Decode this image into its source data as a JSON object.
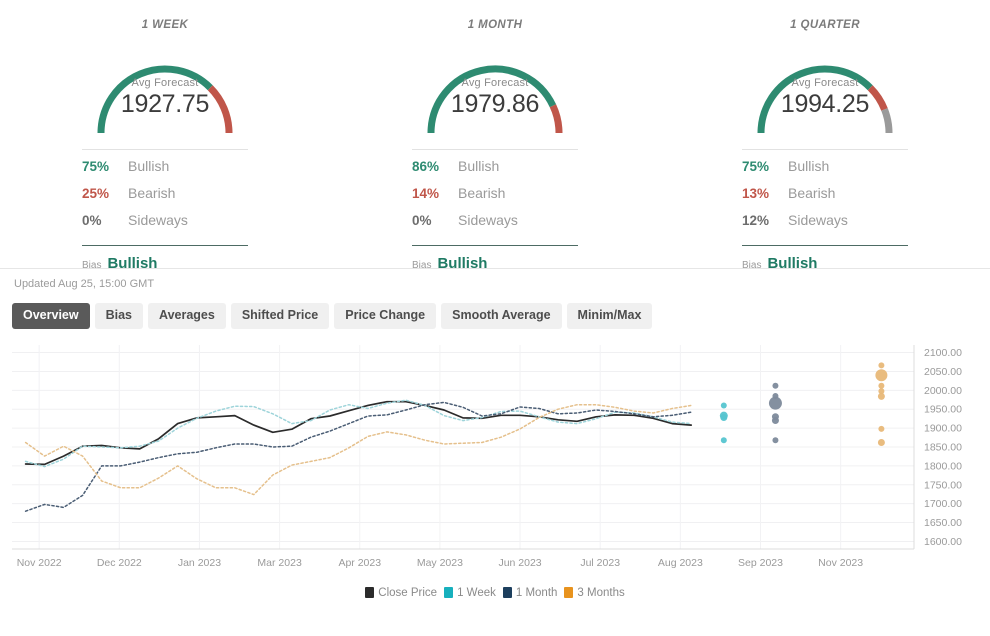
{
  "cards": [
    {
      "title": "1 WEEK",
      "gauge_label": "Avg Forecast",
      "value": "1927.75",
      "bullish_pct": "75%",
      "bullish_label": "Bullish",
      "bearish_pct": "25%",
      "bearish_label": "Bearish",
      "sideways_pct": "0%",
      "sideways_label": "Sideways",
      "bias_label": "Bias",
      "bias_value": "Bullish",
      "arc": {
        "bull": 75,
        "bear": 25,
        "side": 0
      }
    },
    {
      "title": "1 MONTH",
      "gauge_label": "Avg Forecast",
      "value": "1979.86",
      "bullish_pct": "86%",
      "bullish_label": "Bullish",
      "bearish_pct": "14%",
      "bearish_label": "Bearish",
      "sideways_pct": "0%",
      "sideways_label": "Sideways",
      "bias_label": "Bias",
      "bias_value": "Bullish",
      "arc": {
        "bull": 86,
        "bear": 14,
        "side": 0
      }
    },
    {
      "title": "1 QUARTER",
      "gauge_label": "Avg Forecast",
      "value": "1994.25",
      "bullish_pct": "75%",
      "bullish_label": "Bullish",
      "bearish_pct": "13%",
      "bearish_label": "Bearish",
      "sideways_pct": "12%",
      "sideways_label": "Sideways",
      "bias_label": "Bias",
      "bias_value": "Bullish",
      "arc": {
        "bull": 75,
        "bear": 13,
        "side": 12
      }
    }
  ],
  "updated": "Updated Aug 25, 15:00 GMT",
  "tabs": [
    {
      "label": "Overview",
      "active": true
    },
    {
      "label": "Bias",
      "active": false
    },
    {
      "label": "Averages",
      "active": false
    },
    {
      "label": "Shifted Price",
      "active": false
    },
    {
      "label": "Price Change",
      "active": false
    },
    {
      "label": "Smooth Average",
      "active": false
    },
    {
      "label": "Minim/Max",
      "active": false
    }
  ],
  "colors": {
    "bullish": "#2e8b71",
    "bearish": "#c0564a",
    "sideways": "#9a9a9a",
    "close_price": "#2b2b2b",
    "one_week": "#17b0bd",
    "one_month": "#1d3f5e",
    "three_months": "#e8931e"
  },
  "chart_data": {
    "type": "line",
    "title": "",
    "xlabel": "",
    "ylabel": "",
    "ylim": [
      1580,
      2120
    ],
    "yticks": [
      "1600.00",
      "1650.00",
      "1700.00",
      "1750.00",
      "1800.00",
      "1850.00",
      "1900.00",
      "1950.00",
      "2000.00",
      "2050.00",
      "2100.00"
    ],
    "xticks": [
      "Nov 2022",
      "Dec 2022",
      "Jan 2023",
      "Mar 2023",
      "Apr 2023",
      "May 2023",
      "Jun 2023",
      "Jul 2023",
      "Aug 2023",
      "Sep 2023",
      "Nov 2023"
    ],
    "grid": true,
    "legend_position": "bottom",
    "legend": [
      "Close Price",
      "1 Week",
      "1 Month",
      "3 Months"
    ],
    "series": [
      {
        "name": "Close Price",
        "style": "solid",
        "color": "#2b2b2b",
        "x": [
          0.5,
          1.2,
          1.9,
          2.6,
          3.3,
          4.0,
          4.7,
          5.4,
          6.1,
          6.8,
          7.5,
          8.2,
          8.9,
          9.6,
          10.3,
          11.0,
          11.7,
          12.4,
          13.1,
          13.8,
          14.5,
          15.2,
          15.9,
          16.6,
          17.3,
          18.0,
          18.7,
          19.4,
          20.1,
          20.8,
          21.5,
          22.2,
          22.9,
          23.6,
          24.3,
          25.0
        ],
        "values": [
          1805,
          1804,
          1826,
          1852,
          1854,
          1848,
          1845,
          1872,
          1912,
          1927,
          1930,
          1933,
          1908,
          1889,
          1897,
          1925,
          1932,
          1946,
          1960,
          1970,
          1970,
          1960,
          1948,
          1927,
          1926,
          1934,
          1934,
          1930,
          1922,
          1918,
          1930,
          1935,
          1934,
          1926,
          1912,
          1908
        ]
      },
      {
        "name": "1 Week",
        "style": "dotted",
        "color": "#9ed4da",
        "x": [
          0.5,
          1.2,
          1.9,
          2.6,
          3.3,
          4.0,
          4.7,
          5.4,
          6.1,
          6.8,
          7.5,
          8.2,
          8.9,
          9.6,
          10.3,
          11.0,
          11.7,
          12.4,
          13.1,
          13.8,
          14.5,
          15.2,
          15.9,
          16.6,
          17.3,
          18.0,
          18.7,
          19.4,
          20.1,
          20.8,
          21.5,
          22.2,
          22.9,
          23.6,
          24.3,
          25.0
        ],
        "values": [
          1812,
          1798,
          1818,
          1852,
          1850,
          1848,
          1852,
          1866,
          1900,
          1926,
          1945,
          1958,
          1957,
          1938,
          1912,
          1920,
          1948,
          1962,
          1952,
          1966,
          1974,
          1960,
          1933,
          1920,
          1928,
          1944,
          1945,
          1930,
          1916,
          1912,
          1925,
          1942,
          1940,
          1930,
          1916,
          1912
        ]
      },
      {
        "name": "1 Month",
        "style": "dotted",
        "color": "#4a5d74",
        "x": [
          0.5,
          1.2,
          1.9,
          2.6,
          3.3,
          4.0,
          4.7,
          5.4,
          6.1,
          6.8,
          7.5,
          8.2,
          8.9,
          9.6,
          10.3,
          11.0,
          11.7,
          12.4,
          13.1,
          13.8,
          14.5,
          15.2,
          15.9,
          16.6,
          17.3,
          18.0,
          18.7,
          19.4,
          20.1,
          20.8,
          21.5,
          22.2,
          22.9,
          23.6,
          24.3,
          25.0
        ],
        "values": [
          1680,
          1698,
          1690,
          1722,
          1800,
          1800,
          1810,
          1822,
          1832,
          1836,
          1848,
          1858,
          1858,
          1850,
          1852,
          1876,
          1892,
          1912,
          1932,
          1935,
          1948,
          1962,
          1968,
          1955,
          1932,
          1938,
          1956,
          1952,
          1938,
          1940,
          1948,
          1944,
          1938,
          1930,
          1934,
          1942
        ]
      },
      {
        "name": "3 Months",
        "style": "dotted",
        "color": "#e5c08c",
        "x": [
          0.5,
          1.2,
          1.9,
          2.6,
          3.3,
          4.0,
          4.7,
          5.4,
          6.1,
          6.8,
          7.5,
          8.2,
          8.9,
          9.6,
          10.3,
          11.0,
          11.7,
          12.4,
          13.1,
          13.8,
          14.5,
          15.2,
          15.9,
          16.6,
          17.3,
          18.0,
          18.7,
          19.4,
          20.1,
          20.8,
          21.5,
          22.2,
          22.9,
          23.6,
          24.3,
          25.0
        ],
        "values": [
          1862,
          1826,
          1852,
          1826,
          1760,
          1742,
          1742,
          1768,
          1800,
          1766,
          1742,
          1742,
          1724,
          1776,
          1802,
          1812,
          1822,
          1848,
          1878,
          1890,
          1882,
          1868,
          1858,
          1860,
          1862,
          1876,
          1898,
          1928,
          1950,
          1962,
          1962,
          1955,
          1945,
          1940,
          1952,
          1960
        ]
      }
    ],
    "forecast_clusters": [
      {
        "name": "1 Week",
        "color": "#56c5d0",
        "x": 26.2,
        "points": [
          {
            "value": 1960,
            "size": 6
          },
          {
            "value": 1933,
            "size": 8
          },
          {
            "value": 1928,
            "size": 7
          },
          {
            "value": 1868,
            "size": 6
          }
        ]
      },
      {
        "name": "1 Month",
        "color": "#7d8a9b",
        "x": 28.1,
        "points": [
          {
            "value": 2012,
            "size": 6
          },
          {
            "value": 1985,
            "size": 6
          },
          {
            "value": 1966,
            "size": 13
          },
          {
            "value": 1930,
            "size": 7
          },
          {
            "value": 1920,
            "size": 7
          },
          {
            "value": 1868,
            "size": 6
          }
        ]
      },
      {
        "name": "3 Months",
        "color": "#e8b878",
        "x": 32.0,
        "points": [
          {
            "value": 2066,
            "size": 6
          },
          {
            "value": 2040,
            "size": 12
          },
          {
            "value": 2012,
            "size": 6
          },
          {
            "value": 1998,
            "size": 6
          },
          {
            "value": 1984,
            "size": 7
          },
          {
            "value": 1898,
            "size": 6
          },
          {
            "value": 1862,
            "size": 7
          }
        ]
      }
    ]
  }
}
